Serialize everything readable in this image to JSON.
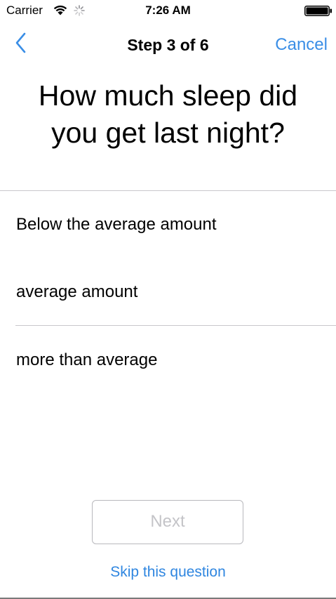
{
  "status_bar": {
    "carrier": "Carrier",
    "time": "7:26 AM",
    "icons": [
      "wifi-icon",
      "activity-spinner-icon",
      "battery-icon"
    ]
  },
  "nav": {
    "back_icon": "chevron-left-icon",
    "title": "Step 3 of 6",
    "cancel_label": "Cancel"
  },
  "question": {
    "line1": "How much sleep did",
    "line2": "you get last night?"
  },
  "options": [
    {
      "label": "Below the average amount"
    },
    {
      "label": "average amount"
    },
    {
      "label": "more than average"
    }
  ],
  "footer": {
    "next_label": "Next",
    "skip_label": "Skip this question"
  },
  "colors": {
    "accent": "#3a8ee6",
    "disabled_text": "#c4c4c8",
    "separator": "#c8c7cc"
  }
}
